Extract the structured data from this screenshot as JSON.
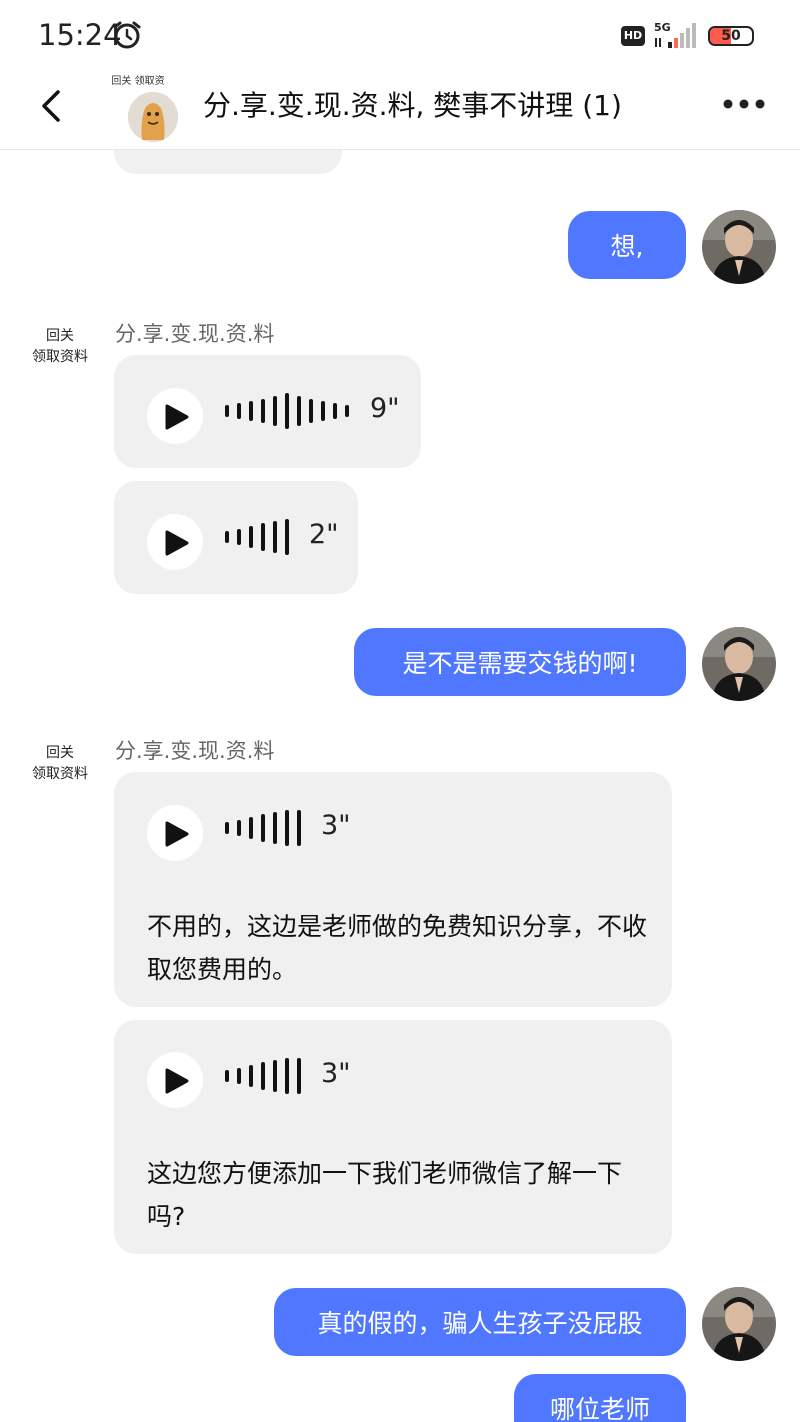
{
  "status_bar": {
    "time": "15:24",
    "network": "5G",
    "hd": "HD",
    "battery": "50",
    "battery_level": 0.5
  },
  "header": {
    "title": "分.享.变.现.资.料, 樊事不讲理 (1)",
    "group_avatar_caption": "回关 领取资"
  },
  "chat": {
    "sender_caption_line1": "回关",
    "sender_caption_line2": "领取资料",
    "sender_name": "分.享.变.现.资.料",
    "outgoing_1": "想,",
    "voice_1_duration": "9\"",
    "voice_2_duration": "2\"",
    "outgoing_2": "是不是需要交钱的啊!",
    "voice_3_duration": "3\"",
    "voice_3_transcript": "不用的，这边是老师做的免费知识分享，不收取您费用的。",
    "voice_4_duration": "3\"",
    "voice_4_transcript": "这边您方便添加一下我们老师微信了解一下吗?",
    "outgoing_3": "真的假的，骗人生孩子没屁股",
    "outgoing_4": "哪位老师"
  },
  "colors": {
    "outgoing_bubble": "#5077ff",
    "incoming_bubble": "#f0f0f0",
    "background": "#ffffff"
  }
}
